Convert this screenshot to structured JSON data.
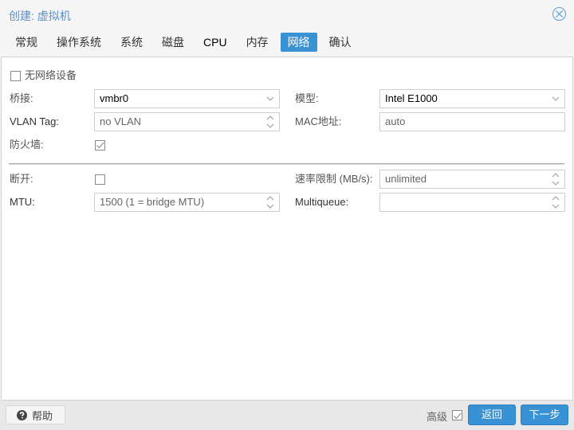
{
  "window": {
    "title": "创建: 虚拟机"
  },
  "tabs": [
    {
      "label": "常规",
      "active": false
    },
    {
      "label": "操作系统",
      "active": false
    },
    {
      "label": "系统",
      "active": false
    },
    {
      "label": "磁盘",
      "active": false
    },
    {
      "label": "CPU",
      "active": false
    },
    {
      "label": "内存",
      "active": false
    },
    {
      "label": "网络",
      "active": true
    },
    {
      "label": "确认",
      "active": false
    }
  ],
  "form": {
    "no_network": {
      "label": "无网络设备",
      "checked": false
    },
    "bridge": {
      "label": "桥接:",
      "value": "vmbr0"
    },
    "model": {
      "label": "模型:",
      "value": "Intel E1000"
    },
    "vlan_tag": {
      "label": "VLAN Tag:",
      "value": "no VLAN"
    },
    "mac_address": {
      "label": "MAC地址:",
      "value": "auto"
    },
    "firewall": {
      "label": "防火墙:",
      "checked": true
    },
    "disconnect": {
      "label": "断开:",
      "checked": false
    },
    "rate_limit": {
      "label": "速率限制 (MB/s):",
      "value": "unlimited"
    },
    "mtu": {
      "label": "MTU:",
      "value": "1500 (1 = bridge MTU)"
    },
    "multiqueue": {
      "label": "Multiqueue:",
      "value": ""
    }
  },
  "footer": {
    "help_label": "帮助",
    "advanced_label": "高级",
    "advanced_checked": true,
    "back_label": "返回",
    "next_label": "下一步"
  },
  "icons": {
    "close": "close-circle-icon",
    "help": "question-circle-icon",
    "dropdown": "chevron-down-icon",
    "spinner": "spinner-updown-icon",
    "check": "checkmark-icon"
  },
  "colors": {
    "accent": "#3892d4",
    "title": "#5b8fc9"
  }
}
